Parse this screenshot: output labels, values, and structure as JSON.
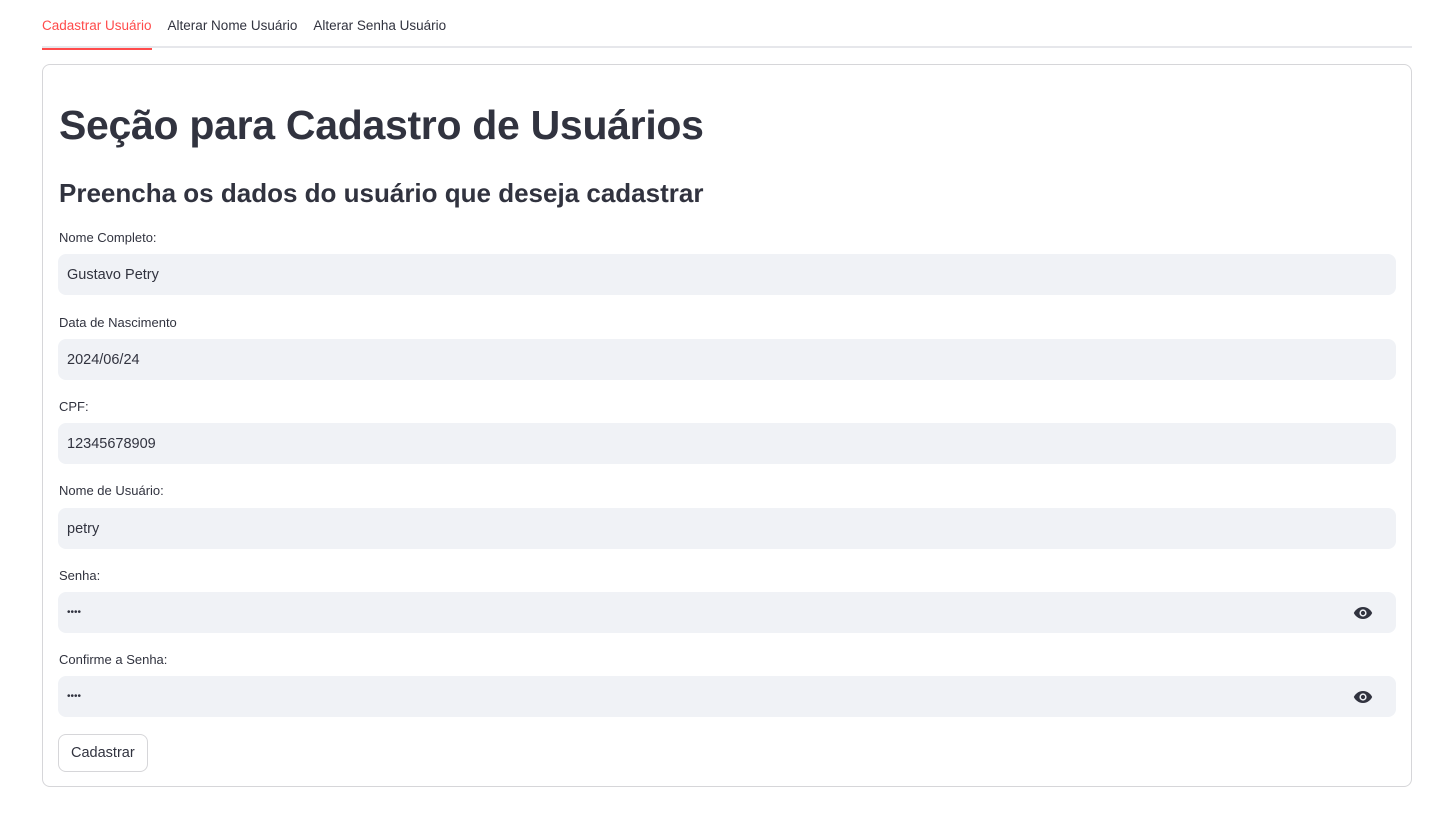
{
  "tabs": [
    {
      "label": "Cadastrar Usuário",
      "active": true
    },
    {
      "label": "Alterar Nome Usuário",
      "active": false
    },
    {
      "label": "Alterar Senha Usuário",
      "active": false
    }
  ],
  "form": {
    "title": "Seção para Cadastro de Usuários",
    "subtitle": "Preencha os dados do usuário que deseja cadastrar",
    "fields": [
      {
        "label": "Nome Completo:",
        "value": "Gustavo Petry",
        "type": "text"
      },
      {
        "label": "Data de Nascimento",
        "value": "2024/06/24",
        "type": "date"
      },
      {
        "label": "CPF:",
        "value": "12345678909",
        "type": "text"
      },
      {
        "label": "Nome de Usuário:",
        "value": "petry",
        "type": "text"
      },
      {
        "label": "Senha:",
        "value": "••••",
        "type": "password",
        "icon": "eye-icon"
      },
      {
        "label": "Confirme a Senha:",
        "value": "••••",
        "type": "password",
        "icon": "eye-icon"
      }
    ],
    "submit_label": "Cadastrar"
  },
  "colors": {
    "accent": "#ff4b4b",
    "text": "#31333f",
    "input_bg": "#f0f2f6",
    "border": "#d6d6d9"
  }
}
